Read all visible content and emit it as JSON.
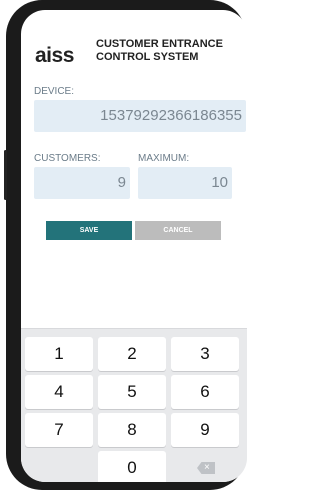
{
  "header": {
    "logo_text": "aiss",
    "title_line1": "CUSTOMER ENTRANCE",
    "title_line2": "CONTROL SYSTEM"
  },
  "device": {
    "label": "DEVICE:",
    "value": "15379292366186355"
  },
  "customers": {
    "label": "CUSTOMERS:",
    "value": "9"
  },
  "maximum": {
    "label": "MAXIMUM:",
    "value": "10"
  },
  "buttons": {
    "save": "SAVE",
    "cancel": "CANCEL",
    "save_color": "#23737a",
    "cancel_color": "#bcbcbc"
  },
  "keypad": {
    "keys": [
      "1",
      "2",
      "3",
      "4",
      "5",
      "6",
      "7",
      "8",
      "9",
      "0"
    ],
    "backspace_icon": "backspace-icon"
  }
}
